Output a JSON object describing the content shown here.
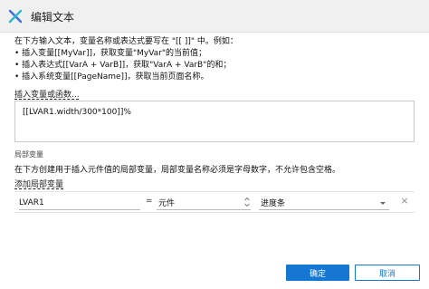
{
  "window": {
    "title": "编辑文本",
    "logo_icon": "axure-x-icon",
    "accent_color": "#1677d2"
  },
  "intro": {
    "lines": [
      "在下方输入文本，变量名称或表达式要写在 \"[[ ]]\" 中。例如：",
      "• 插入变量[[MyVar]]，获取变量\"MyVar\"的当前值；",
      "• 插入表达式[[VarA + VarB]]，获取\"VarA + VarB\"的和；",
      "• 插入系统变量[[PageName]]，获取当前页面名称。"
    ]
  },
  "insert_link": "插入变量或函数...",
  "expression": {
    "value": "[[LVAR1.width/300*100]]%"
  },
  "local_vars": {
    "section_label": "局部变量",
    "description": "在下方创建用于插入元件值的局部变量，局部变量名称必须是字母数字，不允许包含空格。",
    "add_link": "添加局部变量",
    "rows": [
      {
        "name": "LVAR1",
        "equals": "=",
        "type": "元件",
        "target": "进度条",
        "delete": "×"
      }
    ]
  },
  "footer": {
    "ok": "确定",
    "cancel": "取消"
  }
}
